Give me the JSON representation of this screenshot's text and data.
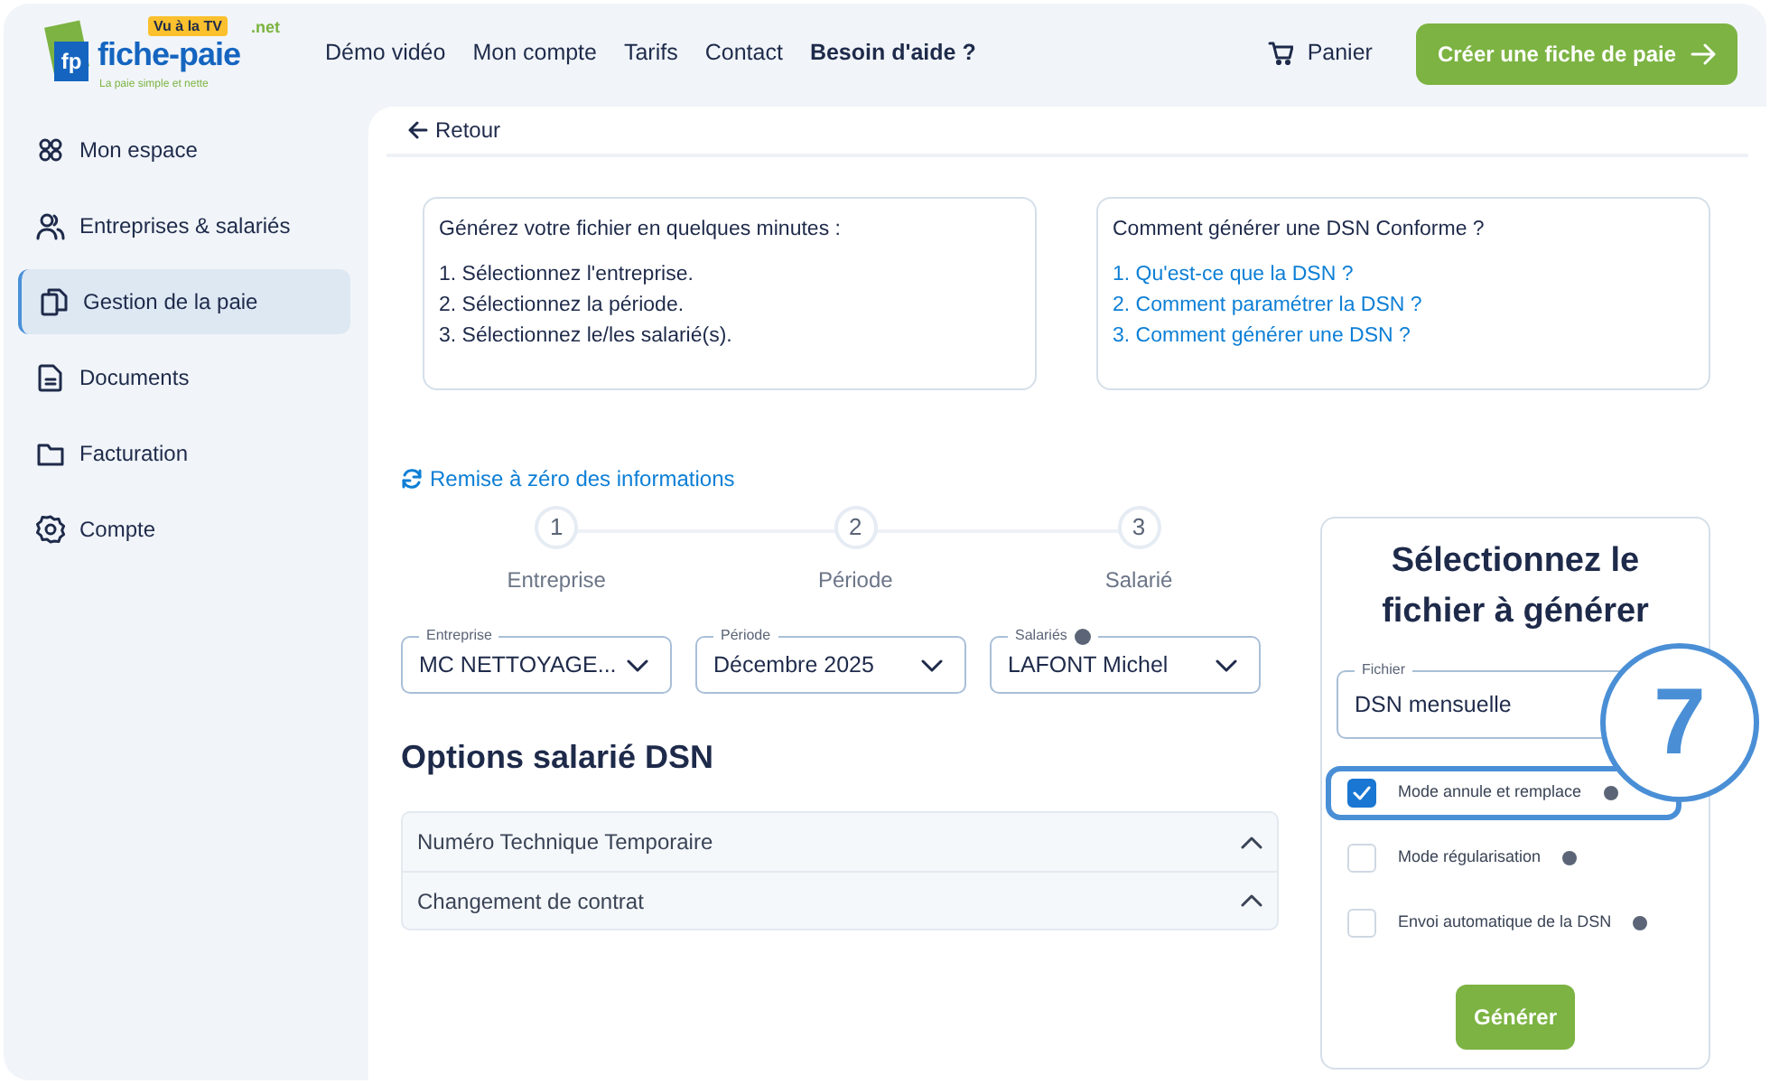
{
  "header": {
    "logo": {
      "mark": "fp",
      "name": "fiche-paie",
      "suffix": ".net",
      "badge": "Vu à la TV",
      "tagline": "La paie simple et nette"
    },
    "nav": [
      {
        "label": "Démo vidéo",
        "bold": false
      },
      {
        "label": "Mon compte",
        "bold": false
      },
      {
        "label": "Tarifs",
        "bold": false
      },
      {
        "label": "Contact",
        "bold": false
      },
      {
        "label": "Besoin d'aide ?",
        "bold": true
      }
    ],
    "cart": "Panier",
    "cta": "Créer une fiche de paie"
  },
  "sidebar": {
    "items": [
      {
        "label": "Mon espace",
        "selected": false
      },
      {
        "label": "Entreprises & salariés",
        "selected": false
      },
      {
        "label": "Gestion de la paie",
        "selected": true
      },
      {
        "label": "Documents",
        "selected": false
      },
      {
        "label": "Facturation",
        "selected": false
      },
      {
        "label": "Compte",
        "selected": false
      }
    ]
  },
  "back": "Retour",
  "info_boxes": [
    {
      "title": "Générez votre fichier en quelques minutes :",
      "items": [
        {
          "text": "1. Sélectionnez l'entreprise.",
          "link": false
        },
        {
          "text": "2. Sélectionnez la période.",
          "link": false
        },
        {
          "text": "3. Sélectionnez le/les salarié(s).",
          "link": false
        }
      ]
    },
    {
      "title": "Comment générer une DSN Conforme ?",
      "items": [
        {
          "text": "1. Qu'est-ce que la DSN ?",
          "link": true
        },
        {
          "text": "2. Comment paramétrer la DSN ?",
          "link": true
        },
        {
          "text": "3. Comment générer une DSN ?",
          "link": true
        }
      ]
    }
  ],
  "reset": "Remise à zéro des informations",
  "steps": [
    {
      "number": "1",
      "label": "Entreprise"
    },
    {
      "number": "2",
      "label": "Période"
    },
    {
      "number": "3",
      "label": "Salarié"
    }
  ],
  "selects": [
    {
      "label": "Entreprise",
      "value": "MC NETTOYAGE...",
      "help": false
    },
    {
      "label": "Période",
      "value": "Décembre 2025",
      "help": false
    },
    {
      "label": "Salariés",
      "value": "LAFONT Michel",
      "help": true
    }
  ],
  "options_title": "Options salarié DSN",
  "accordion": [
    {
      "label": "Numéro Technique Temporaire"
    },
    {
      "label": "Changement de contrat"
    }
  ],
  "file_card": {
    "title": "Sélectionnez le fichier à générer",
    "field": {
      "label": "Fichier",
      "value": "DSN mensuelle"
    },
    "checkboxes": [
      {
        "label": "Mode annule et remplace",
        "checked": true,
        "highlighted": true
      },
      {
        "label": "Mode régularisation",
        "checked": false,
        "highlighted": false
      },
      {
        "label": "Envoi automatique de la DSN",
        "checked": false,
        "highlighted": false
      }
    ],
    "button": "Générer"
  },
  "callout": {
    "number": "7"
  }
}
